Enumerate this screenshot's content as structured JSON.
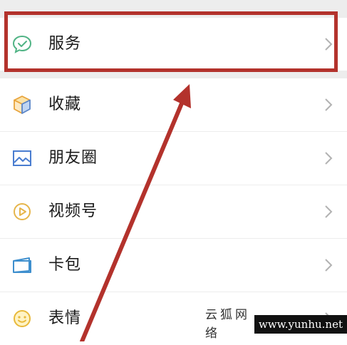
{
  "menu": {
    "items": [
      {
        "label": "服务",
        "icon": "service-icon"
      },
      {
        "label": "收藏",
        "icon": "favorites-cube-icon"
      },
      {
        "label": "朋友圈",
        "icon": "moments-picture-icon"
      },
      {
        "label": "视频号",
        "icon": "channels-play-icon"
      },
      {
        "label": "卡包",
        "icon": "card-wallet-icon"
      },
      {
        "label": "表情",
        "icon": "sticker-smile-icon"
      }
    ]
  },
  "annotation": {
    "highlight_color": "#b3322c",
    "arrow_color": "#b3322c"
  },
  "watermark": {
    "text": "云狐网络",
    "url": "www.yunhu.net"
  }
}
